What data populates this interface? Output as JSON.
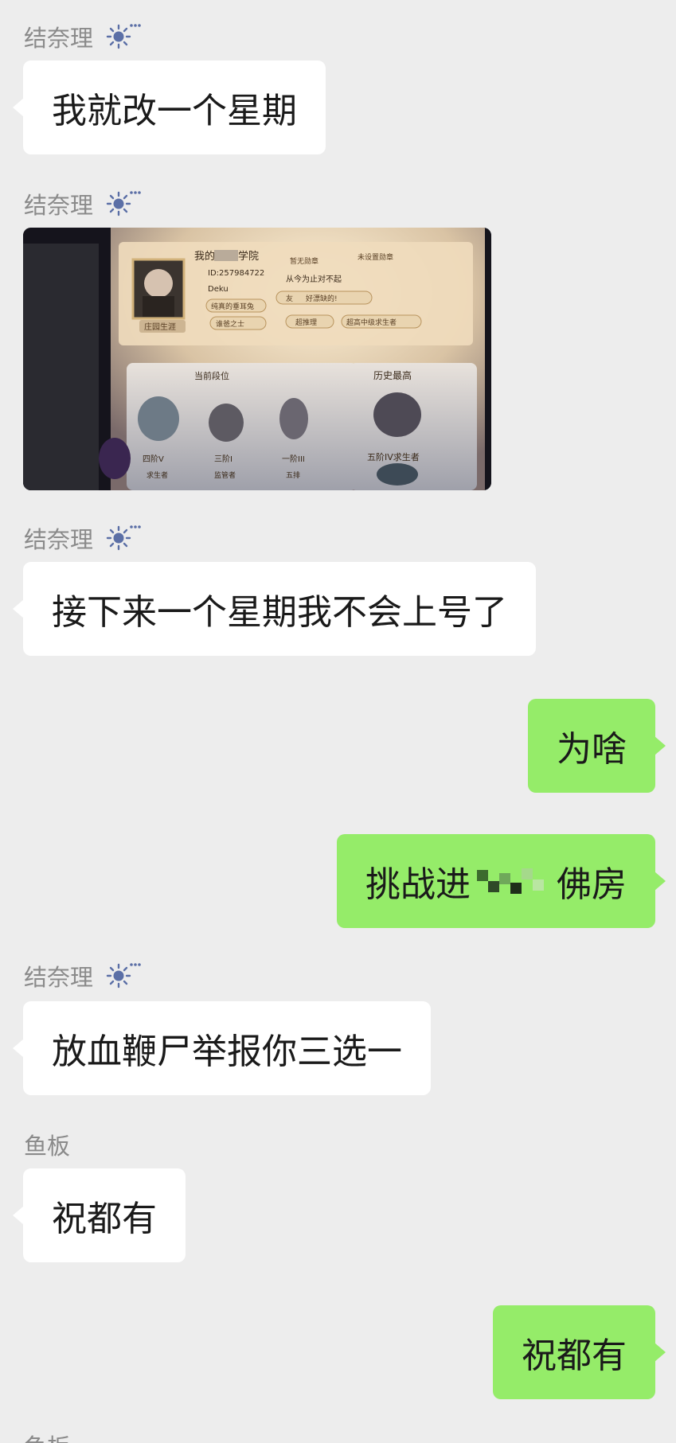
{
  "messages": [
    {
      "type": "text",
      "side": "left",
      "sender": "结奈理",
      "text": "我就改一个星期"
    },
    {
      "type": "image",
      "side": "left",
      "sender": "结奈理",
      "image": {
        "profile_title": "我的",
        "profile_title_suffix": "学院",
        "id_text": "ID:257984722",
        "nickname": "Deku",
        "badge_empty": "暂无勋章",
        "badge_unset": "未设置勋章",
        "tag_1": "纯真的垂耳兔",
        "tag_2": "从今为止对不起",
        "tag_3": "好漂缺的!",
        "tag_4": "友",
        "title_1": "庄园生涯",
        "title_2": "谁爸之士",
        "title_3": "超推理",
        "title_4": "超高中级求生者",
        "current_rank_label": "当前段位",
        "history_label": "历史最高",
        "rank_1": "四阶V",
        "rank_1_role": "求生者",
        "rank_2": "三阶I",
        "rank_2_role": "监管者",
        "rank_3": "一阶III",
        "rank_3_role": "五排",
        "history_rank": "五阶IV求生者"
      }
    },
    {
      "type": "text",
      "side": "left",
      "sender": "结奈理",
      "text": "接下来一个星期我不会上号了"
    },
    {
      "type": "text",
      "side": "right",
      "text": "为啥"
    },
    {
      "type": "text",
      "side": "right",
      "text_before": "挑战进",
      "text_after": "佛房"
    },
    {
      "type": "text",
      "side": "left",
      "sender": "结奈理",
      "text": "放血鞭尸举报你三选一"
    },
    {
      "type": "text",
      "side": "left",
      "sender": "鱼板",
      "text": "祝都有"
    },
    {
      "type": "text",
      "side": "right",
      "text": "祝都有"
    }
  ],
  "footer_sender": "鱼板",
  "colors": {
    "background": "#ededed",
    "left_bubble": "#ffffff",
    "right_bubble": "#95ec69",
    "sender_name": "#8a8a8a",
    "status_icon": "#5b6fa6"
  },
  "icons": {
    "status": "sun-status-icon"
  }
}
